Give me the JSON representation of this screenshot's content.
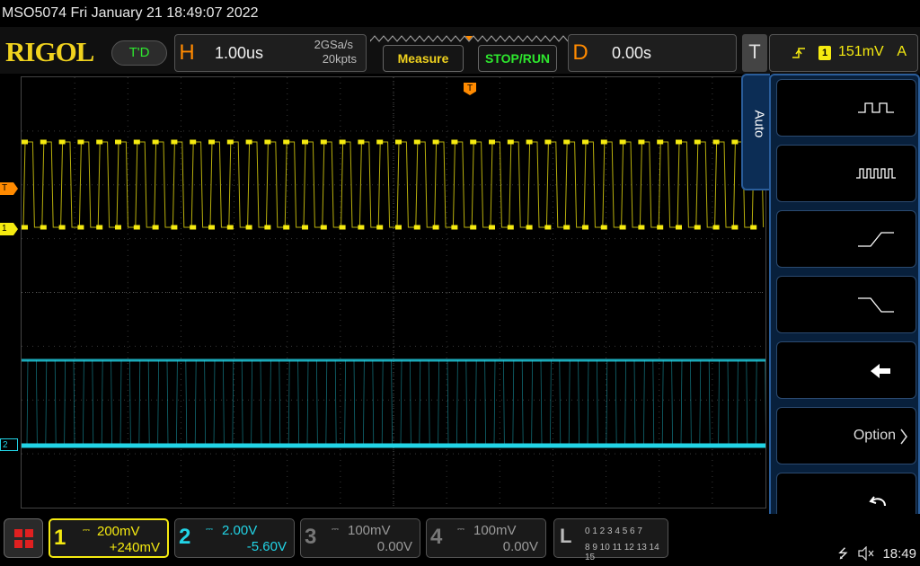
{
  "title": "MSO5074  Fri January 21 18:49:07 2022",
  "toolbar": {
    "logo": "RIGOL",
    "run_state": "T'D",
    "horizontal": {
      "letter": "H",
      "timebase": "1.00us",
      "sample_rate": "2GSa/s",
      "mem_depth": "20kpts"
    },
    "measure_label": "Measure",
    "stop_run_label": "STOP/RUN",
    "delay": {
      "letter": "D",
      "value": "0.00s"
    },
    "trigger": {
      "letter": "T",
      "channel": "1",
      "level": "151mV",
      "mode": "A"
    }
  },
  "markers": {
    "trigger_level": "T",
    "ch1": "1",
    "ch2": "2",
    "trigger_pos": "T"
  },
  "side_panel": {
    "tab_label": "Auto",
    "buttons": [
      {
        "icon": "single-pulse-icon"
      },
      {
        "icon": "multi-pulse-icon"
      },
      {
        "icon": "rising-edge-icon"
      },
      {
        "icon": "falling-edge-icon"
      },
      {
        "icon": "back-arrow-icon"
      },
      {
        "label": "Option"
      },
      {
        "icon": "undo-icon"
      }
    ]
  },
  "channels": [
    {
      "num": "1",
      "scale": "200mV",
      "offset": "+240mV",
      "color": "#f5ea10",
      "active": true
    },
    {
      "num": "2",
      "scale": "2.00V",
      "offset": "-5.60V",
      "color": "#22d4e6",
      "active": false
    },
    {
      "num": "3",
      "scale": "100mV",
      "offset": "0.00V",
      "color": "#9a9a9a",
      "active": false
    },
    {
      "num": "4",
      "scale": "100mV",
      "offset": "0.00V",
      "color": "#9a9a9a",
      "active": false
    }
  ],
  "logic": {
    "letter": "L",
    "row1": "0 1 2 3  4 5 6 7",
    "row2": "8 9 10 11 12 13 14 15"
  },
  "status": {
    "time": "18:49"
  },
  "colors": {
    "ch1": "#f5ea10",
    "ch2": "#22d4e6",
    "accent": "#ff8a00",
    "panel": "#08203c"
  }
}
